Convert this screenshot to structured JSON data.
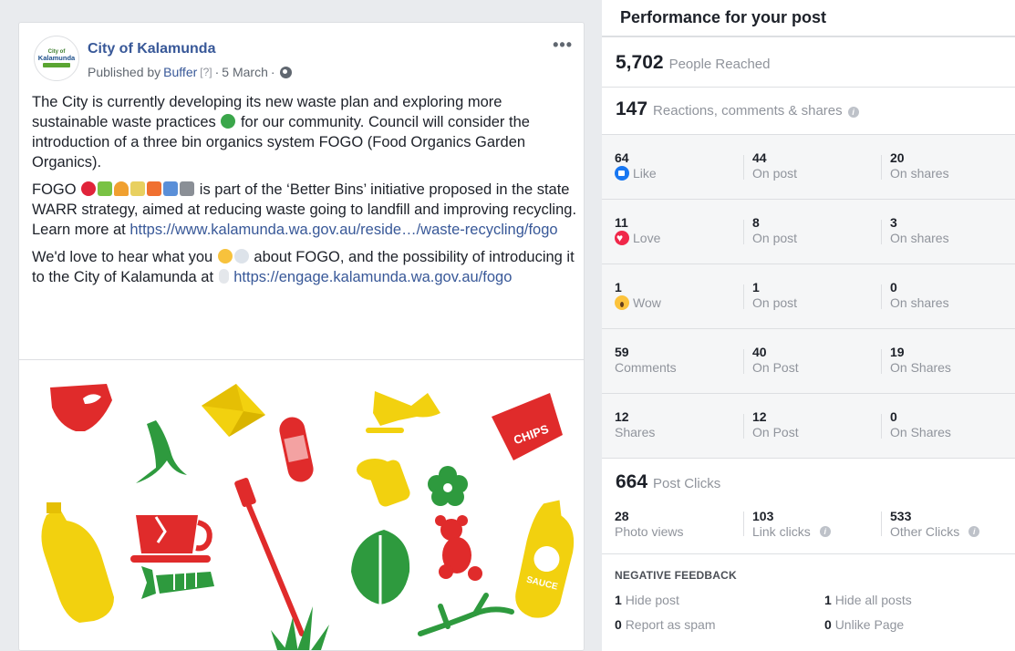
{
  "post": {
    "page_name": "City of Kalamunda",
    "avatar_top": "City of",
    "avatar_main": "Kalamunda",
    "published_by_prefix": "Published by",
    "publisher": "Buffer",
    "publisher_help": "[?]",
    "separator": "·",
    "date": "5 March",
    "separator2": "·",
    "more": "•••",
    "para1_a": "The City is currently developing its new waste plan and exploring more sustainable waste practices",
    "para1_b": "for our community. Council will consider the introduction of a three bin organics system FOGO (Food Organics Garden Organics).",
    "para2_a": "FOGO",
    "para2_b": "is part of the ‘Better Bins’ initiative proposed in the state WARR strategy, aimed at reducing waste going to landfill and improving recycling. Learn more at",
    "para2_link": "https://www.kalamunda.wa.gov.au/reside…/waste-recycling/fogo",
    "para3_a": "We'd love to hear what you",
    "para3_b": "about FOGO, and the possibility of introducing it to the City of Kalamunda at",
    "para3_link": "https://engage.kalamunda.wa.gov.au/fogo",
    "image_chips_text": "CHIPS",
    "image_sauce_text": "SAUCE"
  },
  "insights": {
    "title": "Performance for your post",
    "people_reached": "5,702",
    "people_reached_label": "People Reached",
    "engagement": "147",
    "engagement_label": "Reactions, comments & shares",
    "info_glyph": "i",
    "rows": [
      {
        "c1_num": "64",
        "c1_label": "Like",
        "c2_num": "44",
        "c2_label": "On post",
        "c3_num": "20",
        "c3_label": "On shares"
      },
      {
        "c1_num": "11",
        "c1_label": "Love",
        "c2_num": "8",
        "c2_label": "On post",
        "c3_num": "3",
        "c3_label": "On shares"
      },
      {
        "c1_num": "1",
        "c1_label": "Wow",
        "c2_num": "1",
        "c2_label": "On post",
        "c3_num": "0",
        "c3_label": "On shares"
      },
      {
        "c1_num": "59",
        "c1_label": "Comments",
        "c2_num": "40",
        "c2_label": "On Post",
        "c3_num": "19",
        "c3_label": "On Shares"
      },
      {
        "c1_num": "12",
        "c1_label": "Shares",
        "c2_num": "12",
        "c2_label": "On Post",
        "c3_num": "0",
        "c3_label": "On Shares"
      }
    ],
    "post_clicks": "664",
    "post_clicks_label": "Post Clicks",
    "photo_views": "28",
    "photo_views_label": "Photo views",
    "link_clicks": "103",
    "link_clicks_label": "Link clicks",
    "other_clicks": "533",
    "other_clicks_label": "Other Clicks",
    "negative_title": "NEGATIVE FEEDBACK",
    "hide_post_num": "1",
    "hide_post_label": "Hide post",
    "hide_all_num": "1",
    "hide_all_label": "Hide all posts",
    "spam_num": "0",
    "spam_label": "Report as spam",
    "unlike_num": "0",
    "unlike_label": "Unlike Page"
  },
  "colors": {
    "link": "#385898",
    "red": "#e02b2b",
    "green": "#2e9a3e",
    "yellow": "#f2d10f"
  }
}
